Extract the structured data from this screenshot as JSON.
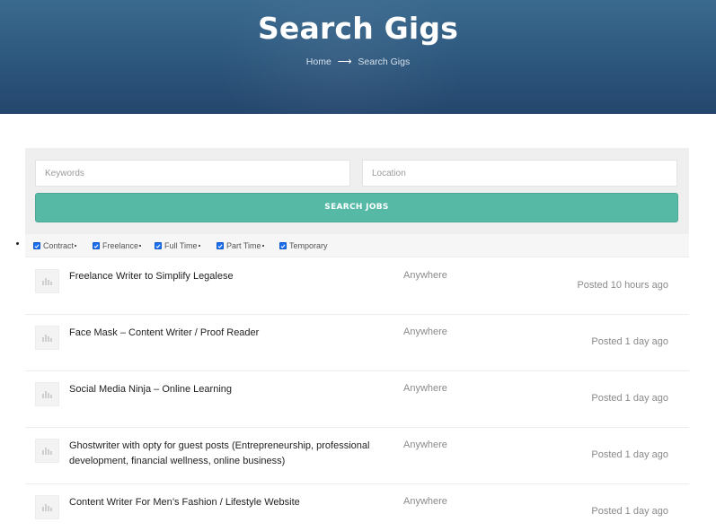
{
  "header": {
    "title": "Search Gigs",
    "breadcrumb": {
      "home": "Home",
      "current": "Search Gigs"
    }
  },
  "search": {
    "keywords_placeholder": "Keywords",
    "keywords_value": "",
    "location_placeholder": "Location",
    "location_value": "",
    "button_label": "SEARCH JOBS"
  },
  "filters": [
    {
      "label": "Contract",
      "checked": true
    },
    {
      "label": "Freelance",
      "checked": true
    },
    {
      "label": "Full Time",
      "checked": true
    },
    {
      "label": "Part Time",
      "checked": true
    },
    {
      "label": "Temporary",
      "checked": true
    }
  ],
  "jobs": [
    {
      "title": "Freelance Writer to Simplify Legalese",
      "location": "Anywhere",
      "posted": "Posted 10 hours ago"
    },
    {
      "title": "Face Mask – Content Writer / Proof Reader",
      "location": "Anywhere",
      "posted": "Posted 1 day ago"
    },
    {
      "title": "Social Media Ninja – Online Learning",
      "location": "Anywhere",
      "posted": "Posted 1 day ago"
    },
    {
      "title": "Ghostwriter with opty for guest posts (Entrepreneurship, professional development, financial wellness, online business)",
      "location": "Anywhere",
      "posted": "Posted 1 day ago"
    },
    {
      "title": "Content Writer For Men’s Fashion / Lifestyle Website",
      "location": "Anywhere",
      "posted": "Posted 1 day ago"
    }
  ],
  "colors": {
    "header_top": "#3b6a8f",
    "header_bottom": "#24466d",
    "search_button": "#55b9a6",
    "checkbox": "#1a6ff0"
  },
  "icons": {
    "breadcrumb_separator": "arrow-right-icon",
    "job_logo": "company-logo-placeholder-icon",
    "filter_check": "checkbox-checked-icon"
  }
}
